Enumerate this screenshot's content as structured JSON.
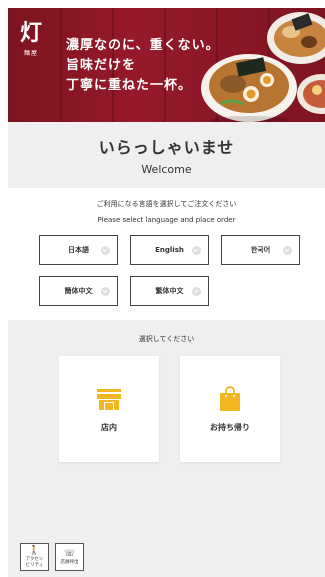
{
  "banner": {
    "logo_glyph": "灯",
    "logo_sub": "麺屋",
    "tagline_lines": [
      "濃厚なのに、重くない。",
      "旨味だけを",
      "丁寧に重ねた一杯。"
    ]
  },
  "welcome": {
    "title_ja": "いらっしゃいませ",
    "title_en": "Welcome"
  },
  "language": {
    "prompt_ja": "ご利用になる言語を選択してご注文ください",
    "prompt_en": "Please select language and place order",
    "options": [
      "日本語",
      "English",
      "한국어",
      "簡体中文",
      "繁体中文"
    ]
  },
  "order": {
    "prompt": "選択してください",
    "dine_in_label": "店内",
    "takeout_label": "お持ち帰り",
    "dine_in_icon": "storefront-icon",
    "takeout_icon": "shopping-bag-icon",
    "accent_color": "#f2b620"
  },
  "utility": {
    "accessibility_label_1": "アクセシ",
    "accessibility_label_2": "ビリティ",
    "staff_call_label": "店員呼出"
  },
  "colors": {
    "banner": "#8f1726",
    "background": "#efefef"
  }
}
